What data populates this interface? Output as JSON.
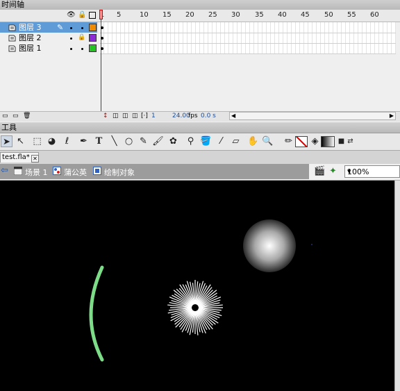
{
  "timeline": {
    "title": "时间轴",
    "frame_numbers": [
      "1",
      "5",
      "10",
      "15",
      "20",
      "25",
      "30",
      "35",
      "40",
      "45",
      "50",
      "55",
      "60"
    ],
    "layers": [
      {
        "name": "图层 3",
        "selected": true,
        "color": "#f08a00",
        "locked": false
      },
      {
        "name": "图层 2",
        "selected": false,
        "color": "#8a2bd6",
        "locked": true
      },
      {
        "name": "图层 1",
        "selected": false,
        "color": "#22c422",
        "locked": false
      }
    ],
    "footer": {
      "frame": "1",
      "fps": "24.00",
      "fps_unit": "fps",
      "time": "0.0 s"
    }
  },
  "tools": {
    "title": "工具",
    "items": [
      "selection-tool",
      "subselection-tool",
      "free-transform-tool",
      "3d-rotation-tool",
      "lasso-tool",
      "pen-tool",
      "text-tool",
      "line-tool",
      "oval-tool",
      "pencil-tool",
      "brush-tool",
      "deco-tool",
      "bone-tool",
      "paint-bucket-tool",
      "eyedropper-tool",
      "eraser-tool",
      "hand-tool",
      "zoom-tool",
      "stroke-color",
      "fill-color",
      "swap-colors"
    ]
  },
  "document": {
    "tab": "test.fla*",
    "breadcrumbs": [
      "场景 1",
      "蒲公英",
      "绘制对象"
    ],
    "zoom": "100%"
  },
  "colors": {
    "stage": "#000000",
    "selection": "#5f9bd6",
    "arc": "#7ddc87"
  }
}
